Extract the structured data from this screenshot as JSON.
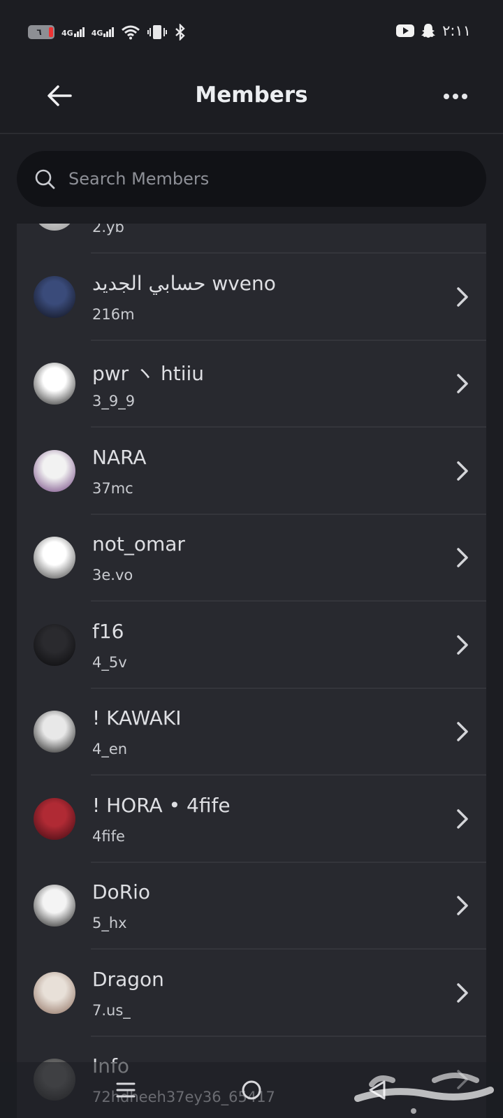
{
  "status_bar": {
    "battery": "٦",
    "network_1": "4G",
    "network_2": "4G",
    "time": "٢:١١"
  },
  "header": {
    "title": "Members",
    "back_icon": "arrow-left-icon",
    "more_icon": "more-horizontal-icon"
  },
  "search": {
    "placeholder": "Search Members",
    "value": ""
  },
  "members": [
    {
      "name": "",
      "username": "2.yb",
      "avatar_colors": [
        "#cfcfcf",
        "#9a9a9a"
      ]
    },
    {
      "name": "حسابي الجديد wveno",
      "username": "216m",
      "avatar_colors": [
        "#3a4b7a",
        "#0e0f18"
      ]
    },
    {
      "name": "pwr ヽ htiiu",
      "username": "3_9_9",
      "avatar_colors": [
        "#ffffff",
        "#1a1a1a"
      ]
    },
    {
      "name": "NARA",
      "username": "37mc",
      "avatar_colors": [
        "#f2f2f2",
        "#6a3a7a"
      ]
    },
    {
      "name": "not_omar",
      "username": "3e.vo",
      "avatar_colors": [
        "#ffffff",
        "#3a3a3a"
      ]
    },
    {
      "name": "f16",
      "username": "4_5v",
      "avatar_colors": [
        "#2a2a2e",
        "#0a0a0c"
      ]
    },
    {
      "name": "!          KAWAKI",
      "username": "4_en",
      "avatar_colors": [
        "#e8e8e8",
        "#111111"
      ]
    },
    {
      "name": "!      HORA  • 4fife",
      "username": "4fife",
      "avatar_colors": [
        "#b02a34",
        "#3a0a12"
      ]
    },
    {
      "name": "DoRio",
      "username": "5_hx",
      "avatar_colors": [
        "#f4f4f4",
        "#141414"
      ]
    },
    {
      "name": "Dragon",
      "username": "7.us_",
      "avatar_colors": [
        "#e8e0d8",
        "#8a6a5a"
      ]
    },
    {
      "name": "Info",
      "username": "72hdheeh37ey36_65417",
      "avatar_colors": [
        "#6a6a6a",
        "#2a2a2a"
      ]
    }
  ],
  "nav": {
    "recent_icon": "menu-icon",
    "home_icon": "circle-icon",
    "back_icon": "triangle-back-icon"
  },
  "watermark": "haraj-logo"
}
